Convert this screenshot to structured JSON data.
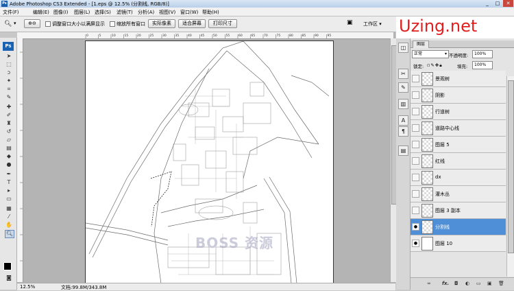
{
  "window": {
    "title": "Adobe Photoshop CS3 Extended - [1.eps @ 12.5% (分割线, RGB/8)]",
    "app_icon": "Ps",
    "controls": [
      "_",
      "□",
      "✕"
    ]
  },
  "menu": [
    "文件(F)",
    "编辑(E)",
    "图像(I)",
    "图层(L)",
    "选择(S)",
    "滤镜(T)",
    "分析(A)",
    "视图(V)",
    "窗口(W)",
    "帮助(H)"
  ],
  "options": {
    "resize_window": "调整窗口大小以满屏显示",
    "zoom_all": "缩放所有窗口",
    "actual_pixels": "实际像素",
    "fit_screen": "适合屏幕",
    "print_size": "打印尺寸",
    "workspace": "工作区 ▾"
  },
  "logo": {
    "brand": "Uzing",
    "suffix": ".net",
    "color": "#e02020"
  },
  "toolbox": {
    "badge": "Ps"
  },
  "canvas": {
    "watermark": "BOSS 资源",
    "ruler_marks": [
      "0",
      "5",
      "10",
      "15",
      "20",
      "25",
      "30",
      "35",
      "40",
      "45",
      "50",
      "55",
      "60",
      "65",
      "70",
      "75",
      "80",
      "85",
      "90",
      "95"
    ]
  },
  "status": {
    "zoom": "12.5%",
    "doc": "文档:99.8M/343.8M"
  },
  "layers_panel": {
    "tab": "图层",
    "blend_mode": "正常",
    "opacity_label": "不透明度:",
    "opacity_value": "100%",
    "lock_label": "锁定:",
    "fill_label": "填充:",
    "fill_value": "100%",
    "accent": "#4f8fd8",
    "layers": [
      {
        "name": "景观树",
        "visible": false,
        "active": false
      },
      {
        "name": "阴影",
        "visible": false,
        "active": false
      },
      {
        "name": "行道树",
        "visible": false,
        "active": false
      },
      {
        "name": "道路中心线",
        "visible": false,
        "active": false
      },
      {
        "name": "图层 5",
        "visible": false,
        "active": false
      },
      {
        "name": "红线",
        "visible": false,
        "active": false
      },
      {
        "name": "dx",
        "visible": false,
        "active": false
      },
      {
        "name": "灌木丛",
        "visible": false,
        "active": false
      },
      {
        "name": "图层 3 副本",
        "visible": false,
        "active": false
      },
      {
        "name": "分割线",
        "visible": true,
        "active": true
      },
      {
        "name": "图层 10",
        "visible": true,
        "active": false
      }
    ],
    "footer_icons": [
      "link-icon",
      "fx-icon",
      "mask-icon",
      "adjustment-icon",
      "folder-icon",
      "new-layer-icon",
      "trash-icon"
    ]
  }
}
